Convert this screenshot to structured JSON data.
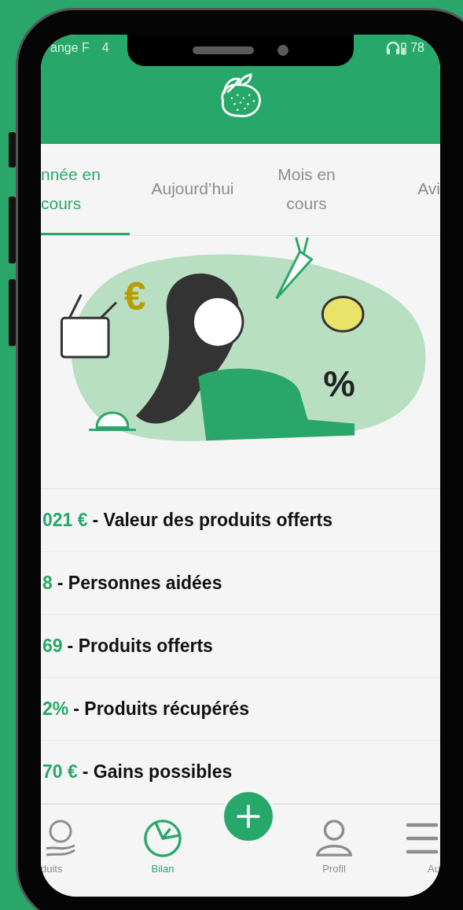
{
  "status_bar": {
    "carrier": "ange F",
    "network": "4",
    "battery": "78"
  },
  "tabs": [
    {
      "label": "nnée en cours",
      "selected": true
    },
    {
      "label": "Aujourd’hui",
      "selected": false
    },
    {
      "label": "Mois en cours",
      "selected": false
    },
    {
      "label": "Avi",
      "selected": false
    }
  ],
  "illustration": {
    "symbols": [
      "€",
      "%"
    ]
  },
  "stats": [
    {
      "value": "021 €",
      "label": "- Valeur des produits offerts"
    },
    {
      "value": "8",
      "label": "- Personnes aidées"
    },
    {
      "value": "69",
      "label": "- Produits offerts"
    },
    {
      "value": "2%",
      "label": "- Produits récupérés"
    },
    {
      "value": "70 €",
      "label": "- Gains possibles"
    }
  ],
  "bottom_nav": [
    {
      "kind": "produce",
      "label": "duits",
      "selected": false
    },
    {
      "kind": "chart",
      "label": "Bilan",
      "selected": true
    },
    {
      "kind": "add",
      "selected": false
    },
    {
      "kind": "profile",
      "label": "Profil",
      "selected": false
    },
    {
      "kind": "menu",
      "label": "Au",
      "selected": false
    }
  ]
}
